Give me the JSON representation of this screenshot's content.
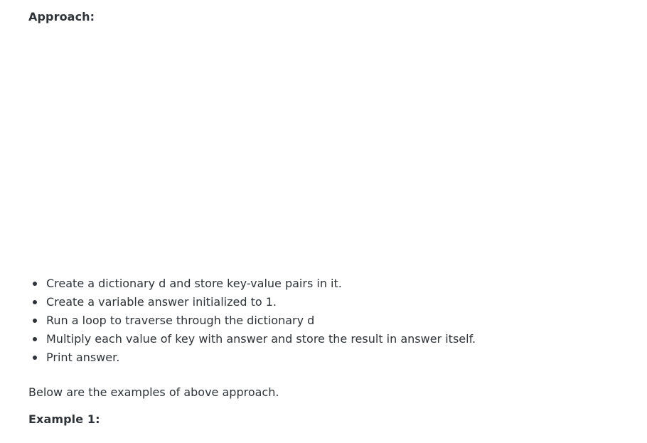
{
  "approach_heading": "Approach:",
  "steps": [
    "Create a dictionary d and store key-value pairs in it.",
    "Create a variable answer initialized to 1.",
    "Run a loop to traverse through the dictionary d",
    "Multiply each value of key with answer and store the result in answer itself.",
    "Print answer."
  ],
  "intro_text": "Below are the examples of above approach.",
  "example_heading": "Example 1:"
}
